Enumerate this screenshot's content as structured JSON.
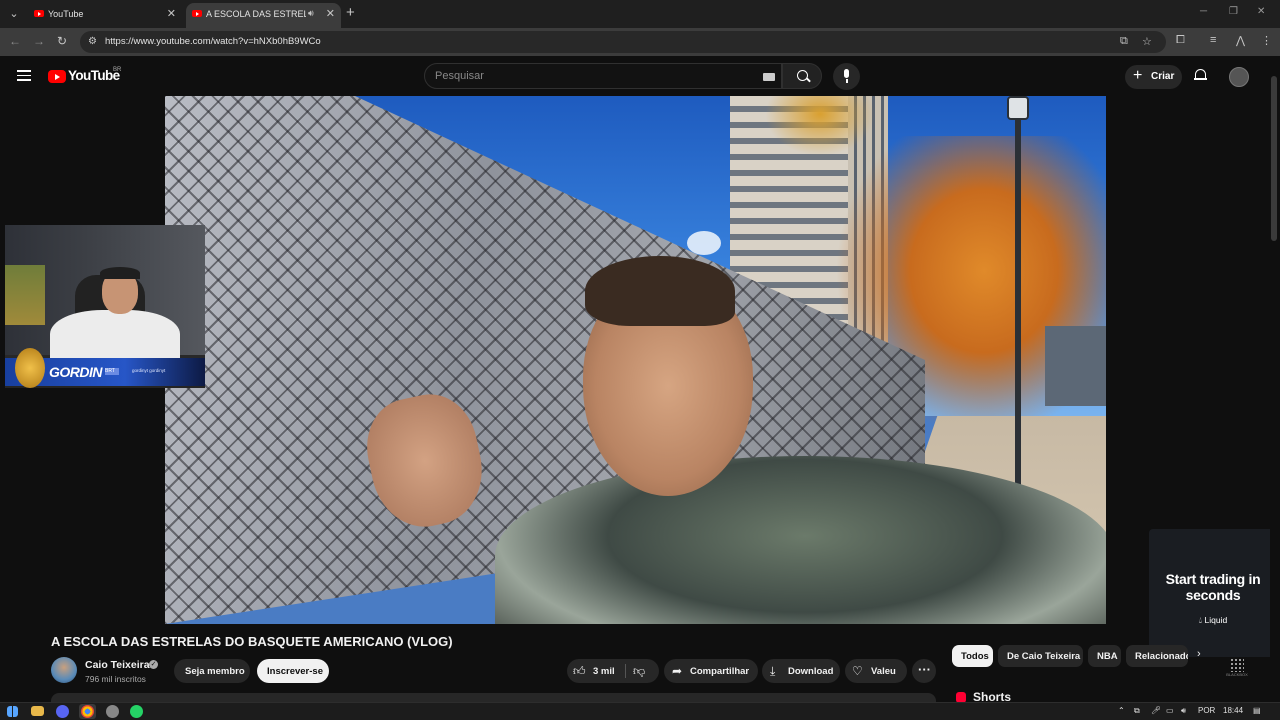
{
  "browser": {
    "tabs": [
      {
        "title": "YouTube",
        "active": false
      },
      {
        "title": "A ESCOLA DAS ESTRELAS D",
        "active": true,
        "audio": true
      }
    ],
    "url": "https://www.youtube.com/watch?v=hNXb0hB9WCo",
    "icons": [
      "tab-dropdown-icon",
      "back-icon",
      "forward-icon",
      "reload-icon",
      "site-info-icon",
      "cast-icon",
      "bookmark-star-icon",
      "extensions-icon",
      "media-icon",
      "profile-icon",
      "menu-kebab-icon",
      "minimize-icon",
      "restore-icon",
      "close-icon"
    ]
  },
  "youtube": {
    "logo_text": "YouTube",
    "region": "BR",
    "search_placeholder": "Pesquisar",
    "create_label": "Criar",
    "brand_color": "#ff0000"
  },
  "overlay": {
    "streamer_name": "GORDIN",
    "tag": "BRT",
    "handles": "gordinyt  gordinyt"
  },
  "video": {
    "title": "A ESCOLA DAS ESTRELAS DO BASQUETE AMERICANO (VLOG)",
    "channel": "Caio Teixeira",
    "subscribers": "796 mil inscritos",
    "join_label": "Seja membro",
    "subscribe_label": "Inscrever-se",
    "likes": "3 mil",
    "share_label": "Compartilhar",
    "download_label": "Download",
    "thanks_label": "Valeu",
    "more_label": "···"
  },
  "ad": {
    "headline": "Start trading in seconds",
    "brand": "Liquid",
    "sponsor": "BLACKBOX"
  },
  "sidebar": {
    "chips": [
      "Todos",
      "De Caio Teixeira",
      "NBA",
      "Relacionados"
    ],
    "active_chip": "Todos",
    "shorts_label": "Shorts"
  },
  "taskbar": {
    "language": "POR",
    "time": "18:44"
  }
}
